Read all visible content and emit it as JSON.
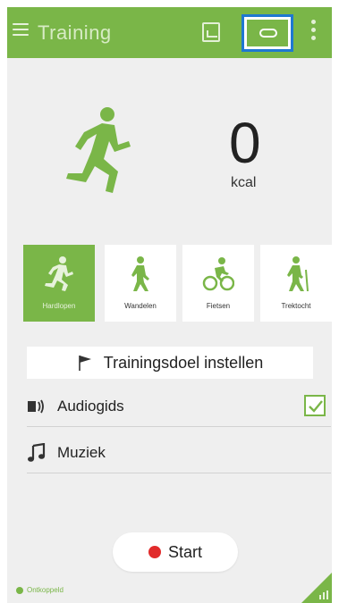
{
  "appbar": {
    "title": "Training",
    "icons": [
      "menu-icon",
      "photo-icon",
      "watch-icon",
      "more-icon"
    ]
  },
  "hero": {
    "kcal_value": "0",
    "kcal_unit": "kcal"
  },
  "activities": [
    {
      "label": "Hardlopen",
      "icon": "runner-icon",
      "active": true
    },
    {
      "label": "Wandelen",
      "icon": "walker-icon",
      "active": false
    },
    {
      "label": "Fietsen",
      "icon": "bicycle-icon",
      "active": false
    },
    {
      "label": "Trektocht",
      "icon": "hiker-icon",
      "active": false
    }
  ],
  "goal": {
    "label": "Trainingsdoel instellen",
    "icon": "flag-icon"
  },
  "rows": {
    "audio": {
      "label": "Audiogids",
      "icon": "audio-guide-icon",
      "checked": true
    },
    "music": {
      "label": "Muziek",
      "icon": "music-note-icon"
    }
  },
  "start": {
    "label": "Start"
  },
  "footer": {
    "status": "Ontkoppeld"
  },
  "colors": {
    "accent": "#7ab648",
    "highlight": "#1f78d1",
    "record": "#e12b2b"
  }
}
